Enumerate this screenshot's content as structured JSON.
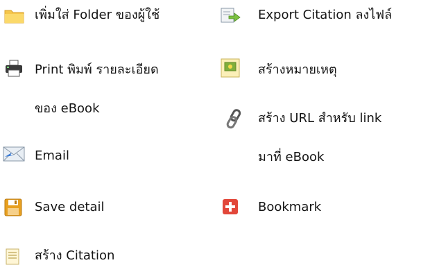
{
  "actions": {
    "add_folder": {
      "label": "เพิ่มใส่ Folder ของผู้ใช้",
      "icon": "folder-icon"
    },
    "print": {
      "label_line1": "Print พิมพ์ รายละเอียด",
      "label_line2": "ของ eBook",
      "icon": "printer-icon"
    },
    "email": {
      "label": "Email",
      "icon": "email-icon"
    },
    "save_detail": {
      "label": "Save detail",
      "icon": "floppy-disk-icon"
    },
    "create_citation": {
      "label": "สร้าง Citation",
      "icon": "citation-document-icon"
    },
    "export_citation": {
      "label": "Export Citation ลงไฟล์",
      "icon": "export-document-icon"
    },
    "create_note": {
      "label": "สร้างหมายเหตุ",
      "icon": "note-icon"
    },
    "create_url": {
      "label_line1": "สร้าง URL  สำหรับ link",
      "label_line2": "มาที่ eBook",
      "icon": "chain-link-icon"
    },
    "bookmark": {
      "label": "Bookmark",
      "icon": "plus-bookmark-icon"
    }
  },
  "colors": {
    "folder": "#F5C54A",
    "printer": "#3A3A3A",
    "floppy": "#E8A020",
    "bookmark": "#E2473A",
    "link": "#555555",
    "note": "#7FAE3C"
  }
}
